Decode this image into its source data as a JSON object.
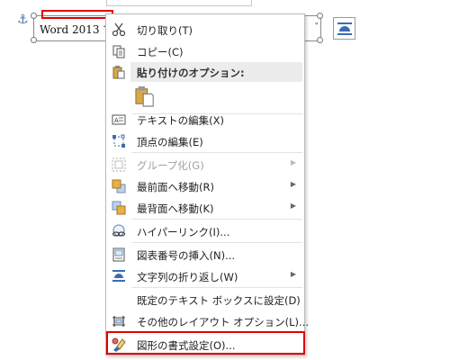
{
  "document": {
    "textbox_text": "Word 2013 で",
    "textbox_edge_text": "ﾞ"
  },
  "context_menu": {
    "cut": "切り取り(T)",
    "copy": "コピー(C)",
    "paste_options_header": "貼り付けのオプション:",
    "edit_text": "テキストの編集(X)",
    "edit_points": "頂点の編集(E)",
    "group": "グループ化(G)",
    "bring_to_front": "最前面へ移動(R)",
    "send_to_back": "最背面へ移動(K)",
    "hyperlink": "ハイパーリンク(I)...",
    "insert_caption": "図表番号の挿入(N)...",
    "wrap_text": "文字列の折り返し(W)",
    "set_default_textbox": "既定のテキスト ボックスに設定(D)",
    "more_layout_options": "その他のレイアウト オプション(L)...",
    "format_shape": "図形の書式設定(O)..."
  },
  "colors": {
    "highlight": "#e00000",
    "disabled_text": "#a0a0a0",
    "section_header_bg": "#ececec"
  },
  "icons": {
    "cut": "scissors-icon",
    "copy": "copy-icon",
    "paste": "clipboard-icon",
    "edit_text": "textbox-icon",
    "edit_points": "edit-points-icon",
    "group": "group-icon",
    "bring_front": "bring-to-front-icon",
    "send_back": "send-to-back-icon",
    "hyperlink": "link-icon",
    "caption": "caption-icon",
    "wrap": "wrap-text-icon",
    "layout": "layout-options-icon",
    "format_shape": "format-shape-icon",
    "anchor": "anchor-icon"
  }
}
